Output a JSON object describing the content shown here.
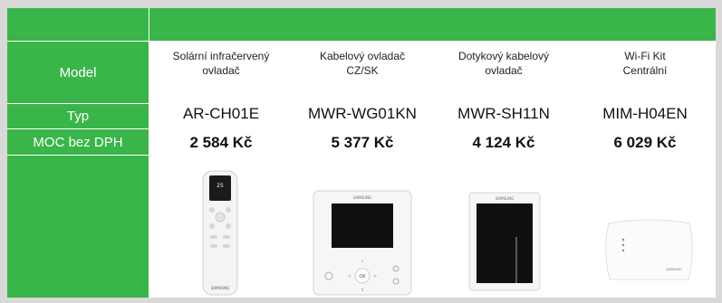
{
  "labels": {
    "model": "Model",
    "typ": "Typ",
    "moc": "MOC bez DPH"
  },
  "products": [
    {
      "name_line1": "Solární infračervený",
      "name_line2": "ovladač",
      "code": "AR-CH01E",
      "price": "2 584 Kč",
      "image": "ir-remote-controller"
    },
    {
      "name_line1": "Kabelový ovladač",
      "name_line2": "CZ/SK",
      "code": "MWR-WG01KN",
      "price": "5 377 Kč",
      "image": "wired-controller"
    },
    {
      "name_line1": "Dotykový kabelový",
      "name_line2": "ovladač",
      "code": "MWR-SH11N",
      "price": "4 124 Kč",
      "image": "touch-wired-controller"
    },
    {
      "name_line1": "Wi-Fi Kit",
      "name_line2": "Centrální",
      "code": "MIM-H04EN",
      "price": "6 029 Kč",
      "image": "wifi-kit"
    }
  ],
  "brand_marks": {
    "samsung": "SAMSUNG",
    "ok_label": "OK"
  },
  "colors": {
    "header_green": "#3ab54a",
    "background": "#d9d9d9"
  }
}
